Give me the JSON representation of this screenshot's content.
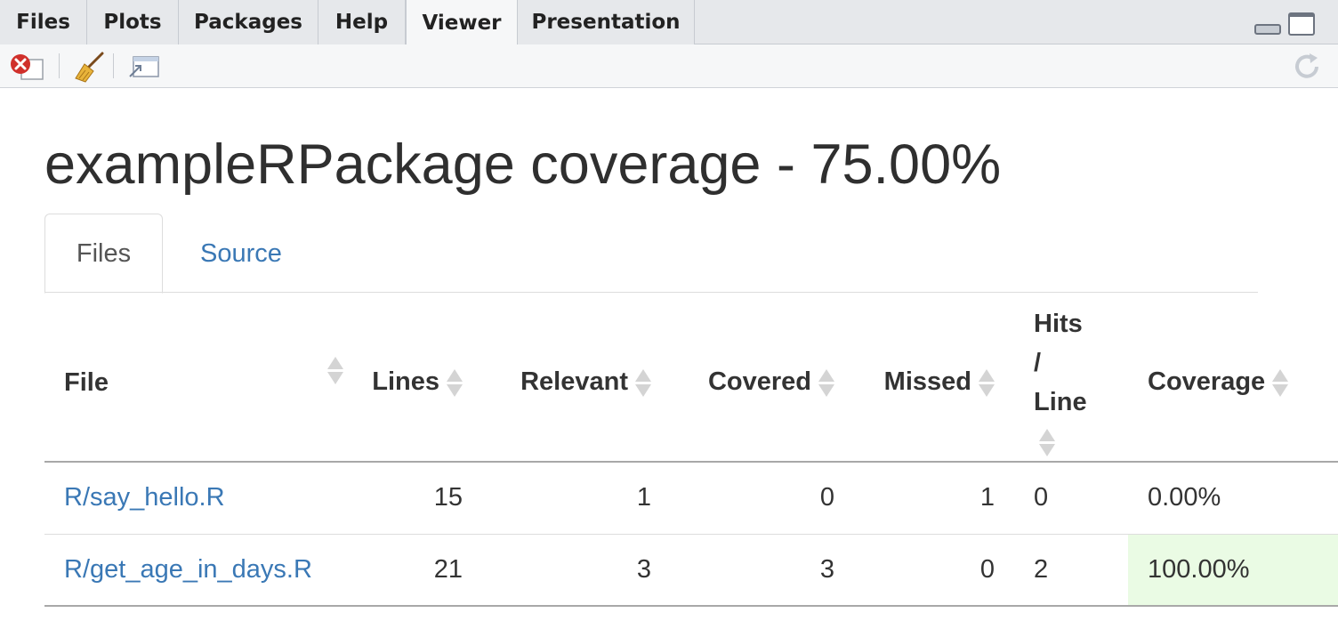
{
  "pane_tabs": [
    {
      "label": "Files"
    },
    {
      "label": "Plots"
    },
    {
      "label": "Packages"
    },
    {
      "label": "Help"
    },
    {
      "label": "Viewer",
      "active": true
    },
    {
      "label": "Presentation"
    }
  ],
  "toolbar": {
    "icons": [
      "remove-viewer-icon",
      "clear-all-icon",
      "show-in-new-window-icon",
      "refresh-icon"
    ]
  },
  "page": {
    "title": "exampleRPackage coverage - 75.00%",
    "tabs": [
      {
        "label": "Files",
        "active": true
      },
      {
        "label": "Source",
        "active": false
      }
    ]
  },
  "table": {
    "columns": [
      "File",
      "Lines",
      "Relevant",
      "Covered",
      "Missed",
      "Hits / Line",
      "Coverage"
    ],
    "rows": [
      {
        "file": "R/say_hello.R",
        "lines": "15",
        "relevant": "1",
        "covered": "0",
        "missed": "1",
        "hits_per_line": "0",
        "coverage": "0.00%"
      },
      {
        "file": "R/get_age_in_days.R",
        "lines": "21",
        "relevant": "3",
        "covered": "3",
        "missed": "0",
        "hits_per_line": "2",
        "coverage": "100.00%"
      }
    ]
  },
  "colors": {
    "link": "#3a78b5",
    "full_coverage_bg": "#eafbe4",
    "close_red": "#d0302b"
  }
}
